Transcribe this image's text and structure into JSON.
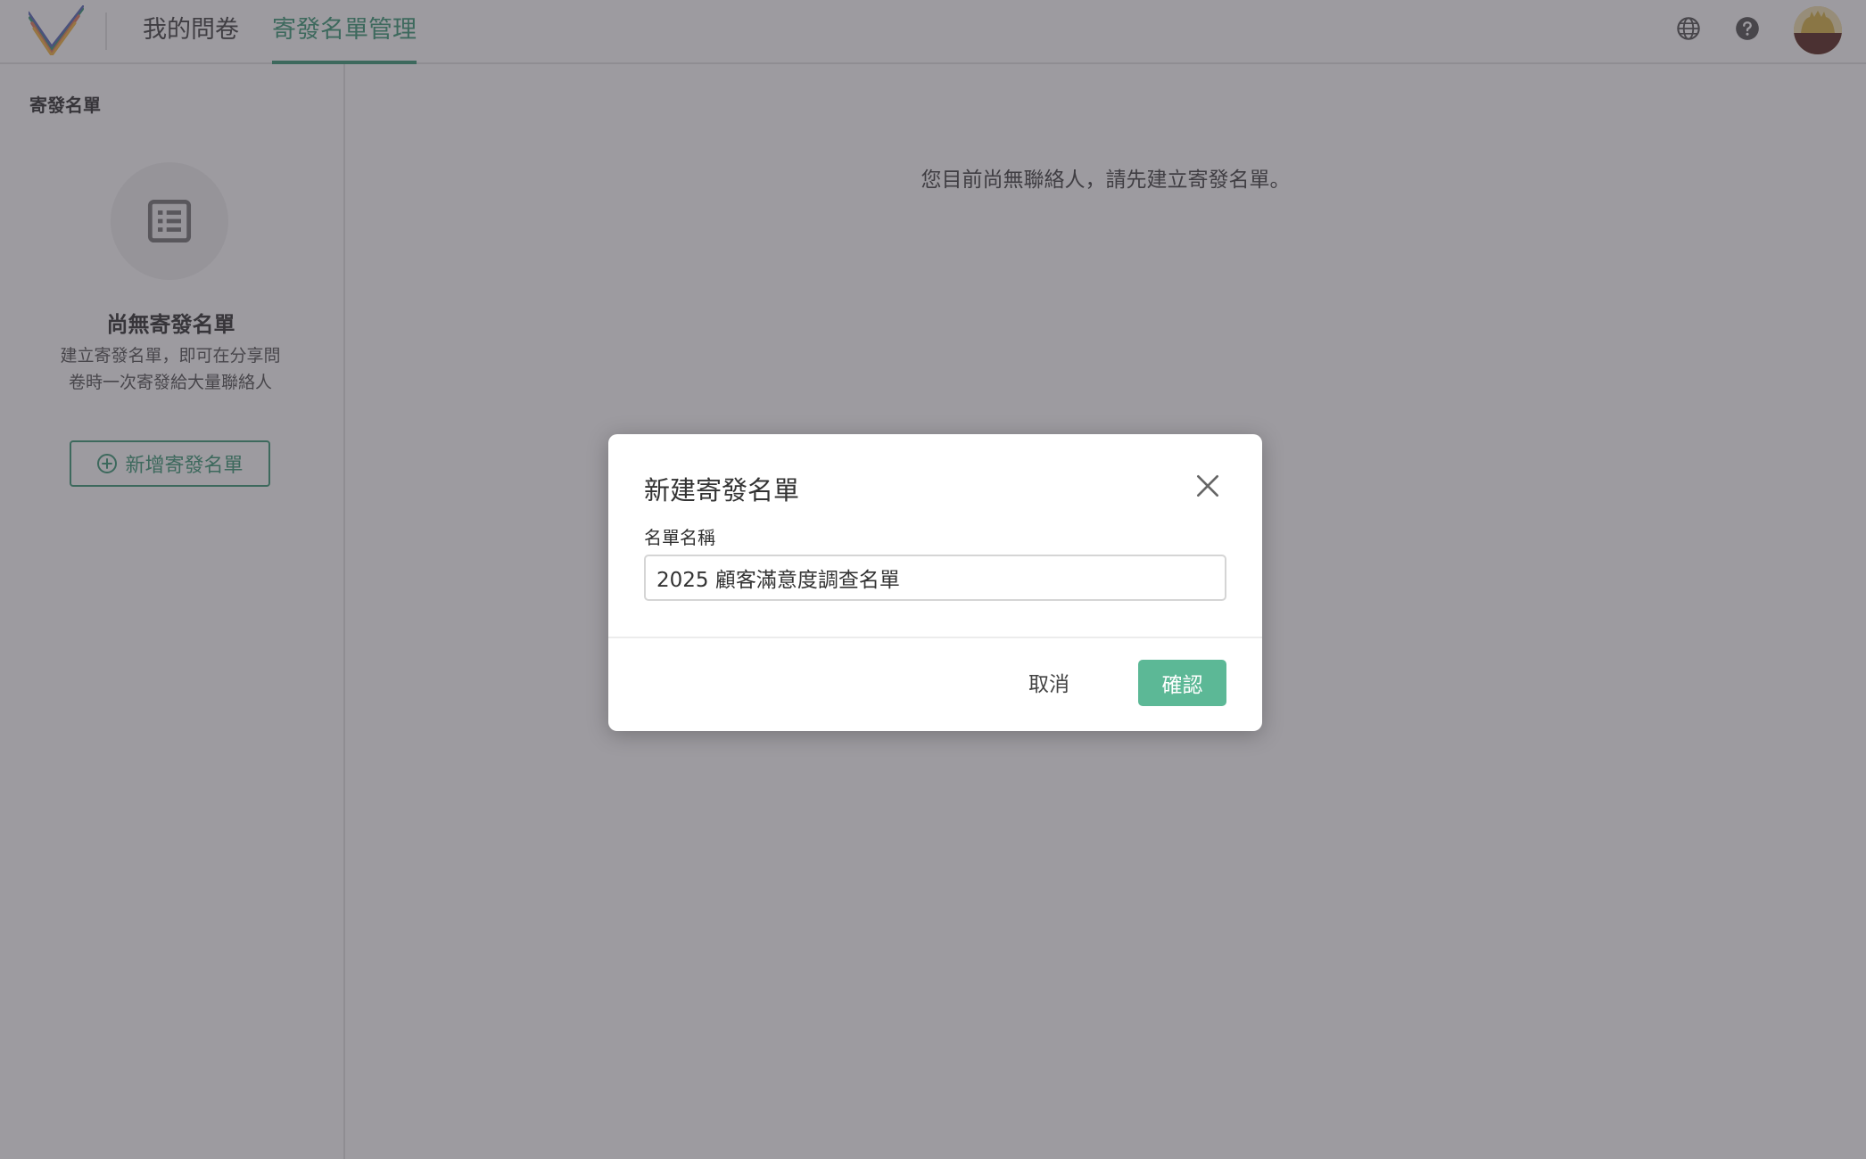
{
  "header": {
    "logo_icon": "checkmark-logo-icon",
    "tabs": [
      {
        "label": "我的問卷",
        "active": false
      },
      {
        "label": "寄發名單管理",
        "active": true
      }
    ],
    "icons": [
      "globe-icon",
      "help-icon"
    ],
    "accent_color": "#3f9a78"
  },
  "sidebar": {
    "title": "寄發名單",
    "empty_icon": "list-icon",
    "empty_title": "尚無寄發名單",
    "empty_desc_line1": "建立寄發名單，即可在分享問",
    "empty_desc_line2": "卷時一次寄發給大量聯絡人",
    "add_button_label": "新增寄發名單",
    "add_button_icon": "plus-circle-icon"
  },
  "main": {
    "empty_message": "您目前尚無聯絡人，請先建立寄發名單。"
  },
  "modal": {
    "title": "新建寄發名單",
    "close_icon": "close-icon",
    "field_label": "名單名稱",
    "field_value": "2025 顧客滿意度調查名單",
    "cancel_label": "取消",
    "confirm_label": "確認",
    "confirm_color": "#5cb896"
  }
}
